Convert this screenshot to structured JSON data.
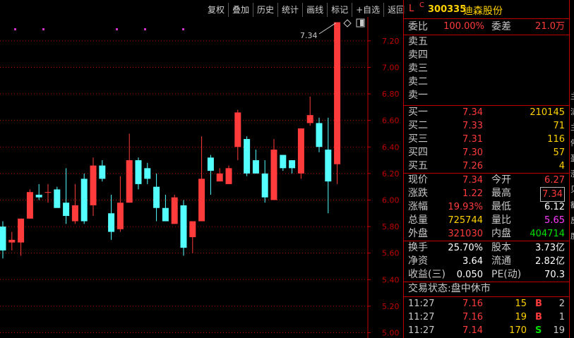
{
  "toolbar": [
    "复权",
    "叠加",
    "历史",
    "统计",
    "画线",
    "标记",
    "+自选",
    "返回"
  ],
  "chart_data": {
    "type": "candlestick",
    "y_ticks": [
      "7.20",
      "7.00",
      "6.80",
      "6.60",
      "6.40",
      "6.20",
      "6.00",
      "5.80",
      "5.60",
      "5.40",
      "5.20",
      "5.00"
    ],
    "ylim": [
      4.96,
      7.38
    ],
    "candles": [
      {
        "o": 5.8,
        "h": 5.84,
        "l": 5.56,
        "c": 5.62
      },
      {
        "o": 5.68,
        "h": 5.76,
        "l": 5.62,
        "c": 5.7
      },
      {
        "o": 5.68,
        "h": 5.86,
        "l": 5.58,
        "c": 5.86
      },
      {
        "o": 5.86,
        "h": 6.08,
        "l": 5.86,
        "c": 6.06
      },
      {
        "o": 6.04,
        "h": 6.12,
        "l": 6.0,
        "c": 6.02
      },
      {
        "o": 6.06,
        "h": 6.12,
        "l": 5.98,
        "c": 6.06
      },
      {
        "o": 6.08,
        "h": 6.1,
        "l": 5.96,
        "c": 5.94
      },
      {
        "o": 5.98,
        "h": 6.24,
        "l": 5.82,
        "c": 5.88
      },
      {
        "o": 5.84,
        "h": 6.12,
        "l": 5.82,
        "c": 5.96
      },
      {
        "o": 6.16,
        "h": 6.2,
        "l": 5.82,
        "c": 5.84
      },
      {
        "o": 5.96,
        "h": 6.32,
        "l": 5.88,
        "c": 6.26
      },
      {
        "o": 6.26,
        "h": 6.3,
        "l": 6.14,
        "c": 6.16
      },
      {
        "o": 5.9,
        "h": 6.04,
        "l": 5.7,
        "c": 5.76
      },
      {
        "o": 5.78,
        "h": 6.18,
        "l": 5.76,
        "c": 5.98
      },
      {
        "o": 5.98,
        "h": 6.5,
        "l": 6.0,
        "c": 6.3
      },
      {
        "o": 6.3,
        "h": 6.32,
        "l": 6.08,
        "c": 6.12
      },
      {
        "o": 6.24,
        "h": 6.28,
        "l": 6.12,
        "c": 6.16
      },
      {
        "o": 6.1,
        "h": 6.2,
        "l": 5.84,
        "c": 5.94
      },
      {
        "o": 5.94,
        "h": 6.04,
        "l": 5.86,
        "c": 5.84
      },
      {
        "o": 5.82,
        "h": 6.04,
        "l": 5.82,
        "c": 6.02
      },
      {
        "o": 5.96,
        "h": 6.0,
        "l": 5.58,
        "c": 5.64
      },
      {
        "o": 5.72,
        "h": 5.82,
        "l": 5.6,
        "c": 5.84
      },
      {
        "o": 5.84,
        "h": 6.48,
        "l": 5.86,
        "c": 6.16
      },
      {
        "o": 6.32,
        "h": 6.34,
        "l": 6.04,
        "c": 6.22
      },
      {
        "o": 6.14,
        "h": 6.24,
        "l": 6.14,
        "c": 6.2
      },
      {
        "o": 6.12,
        "h": 6.26,
        "l": 6.14,
        "c": 6.24
      },
      {
        "o": 6.4,
        "h": 6.68,
        "l": 6.3,
        "c": 6.66
      },
      {
        "o": 6.46,
        "h": 6.48,
        "l": 6.18,
        "c": 6.2
      },
      {
        "o": 6.3,
        "h": 6.38,
        "l": 6.2,
        "c": 6.2
      },
      {
        "o": 6.2,
        "h": 6.3,
        "l": 5.98,
        "c": 6.02
      },
      {
        "o": 6.0,
        "h": 6.46,
        "l": 6.0,
        "c": 6.38
      },
      {
        "o": 6.34,
        "h": 6.34,
        "l": 6.22,
        "c": 6.24
      },
      {
        "o": 6.3,
        "h": 6.3,
        "l": 6.2,
        "c": 6.24
      },
      {
        "o": 6.2,
        "h": 6.54,
        "l": 6.16,
        "c": 6.54
      },
      {
        "o": 6.58,
        "h": 6.78,
        "l": 6.56,
        "c": 6.64
      },
      {
        "o": 6.58,
        "h": 6.62,
        "l": 6.36,
        "c": 6.4
      },
      {
        "o": 6.38,
        "h": 6.62,
        "l": 5.9,
        "c": 6.14
      },
      {
        "o": 6.27,
        "h": 7.34,
        "l": 6.12,
        "c": 7.34
      }
    ],
    "annotation": "7.34",
    "markers": 5
  },
  "header": {
    "l": "L",
    "c": "C",
    "code": "300335",
    "name": "迪森股份"
  },
  "weibi": {
    "lab": "委比",
    "val": "100.00%",
    "lab2": "委差",
    "val2": "21.0万"
  },
  "sells": [
    "卖五",
    "卖四",
    "卖三",
    "卖二",
    "卖一"
  ],
  "buys": [
    {
      "lab": "买一",
      "price": "7.34",
      "vol": "210145"
    },
    {
      "lab": "买二",
      "price": "7.33",
      "vol": "71"
    },
    {
      "lab": "买三",
      "price": "7.31",
      "vol": "116"
    },
    {
      "lab": "买四",
      "price": "7.30",
      "vol": "57"
    },
    {
      "lab": "买五",
      "price": "7.26",
      "vol": "4"
    }
  ],
  "quote": [
    {
      "l1": "现价",
      "v1": "7.34",
      "c1": "red",
      "l2": "今开",
      "v2": "6.27",
      "c2": "red"
    },
    {
      "l1": "涨跌",
      "v1": "1.22",
      "c1": "red",
      "l2": "最高",
      "v2": "7.34",
      "c2": "red",
      "box": true
    },
    {
      "l1": "涨幅",
      "v1": "19.93%",
      "c1": "red",
      "l2": "最低",
      "v2": "6.12",
      "c2": "wht"
    },
    {
      "l1": "总量",
      "v1": "725744",
      "c1": "yel",
      "l2": "量比",
      "v2": "5.65",
      "c2": "pur"
    },
    {
      "l1": "外盘",
      "v1": "321030",
      "c1": "red",
      "l2": "内盘",
      "v2": "404714",
      "c2": "grn"
    }
  ],
  "finance": [
    {
      "l1": "换手",
      "v1": "25.70%",
      "l2": "股本",
      "v2": "3.73亿"
    },
    {
      "l1": "净资",
      "v1": "3.64",
      "l2": "流通",
      "v2": "2.82亿"
    },
    {
      "l1": "收益(三)",
      "v1": "0.050",
      "l2": "PE(动)",
      "v2": "70.3"
    }
  ],
  "status": "交易状态:盘中休市",
  "trades": [
    {
      "time": "11:27",
      "price": "7.16",
      "vol": "15",
      "bs": "B",
      "n": "2"
    },
    {
      "time": "11:27",
      "price": "7.16",
      "vol": "19",
      "bs": "B",
      "n": "1"
    },
    {
      "time": "11:27",
      "price": "7.14",
      "vol": "170",
      "bs": "S",
      "n": "19"
    }
  ],
  "right_strip": [
    "主",
    "流",
    "主",
    "停",
    "盈",
    "涨",
    "贝",
    "额",
    "反",
    "度"
  ],
  "colors": {
    "up": "#ff3b3b",
    "down": "#54ffff",
    "grid": "#c00000",
    "marker": "#cc33cc"
  }
}
